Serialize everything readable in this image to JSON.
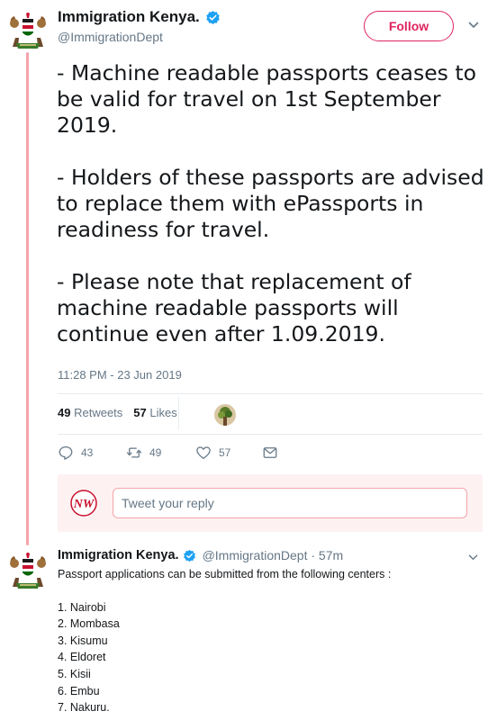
{
  "tweet": {
    "display_name": "Immigration Kenya.",
    "handle": "@ImmigrationDept",
    "follow_label": "Follow",
    "text": "- Machine readable passports ceases to be valid for travel on 1st September 2019.\n\n- Holders of these passports are advised to replace them with ePassports in readiness for travel.\n\n- Please note that replacement of machine readable passports will continue even after 1.09.2019.",
    "timestamp": "11:28 PM - 23 Jun 2019",
    "retweets_count": "49",
    "retweets_label": "Retweets",
    "likes_count": "57",
    "likes_label": "Likes",
    "actions": {
      "replies": "43",
      "retweets": "49",
      "likes": "57"
    }
  },
  "reply_box": {
    "logo_text": "NW",
    "placeholder": "Tweet your reply"
  },
  "reply_tweet": {
    "display_name": "Immigration Kenya.",
    "handle_time": "@ImmigrationDept · 57m",
    "intro": "Passport applications can be submitted from the following centers :",
    "centers": [
      "1. Nairobi",
      "2. Mombasa",
      "3. Kisumu",
      "4. Eldoret",
      "5. Kisii",
      "6. Embu",
      "7. Nakuru."
    ]
  },
  "colors": {
    "accent": "#e0245e",
    "verified": "#1da1f2",
    "thread_line": "#f5a4aa",
    "muted_text": "#657786"
  },
  "icons": [
    "coat-of-arms-icon",
    "verified-badge-icon",
    "chevron-down-icon",
    "reply-icon",
    "retweet-icon",
    "heart-icon",
    "message-icon",
    "nw-logo-icon"
  ]
}
